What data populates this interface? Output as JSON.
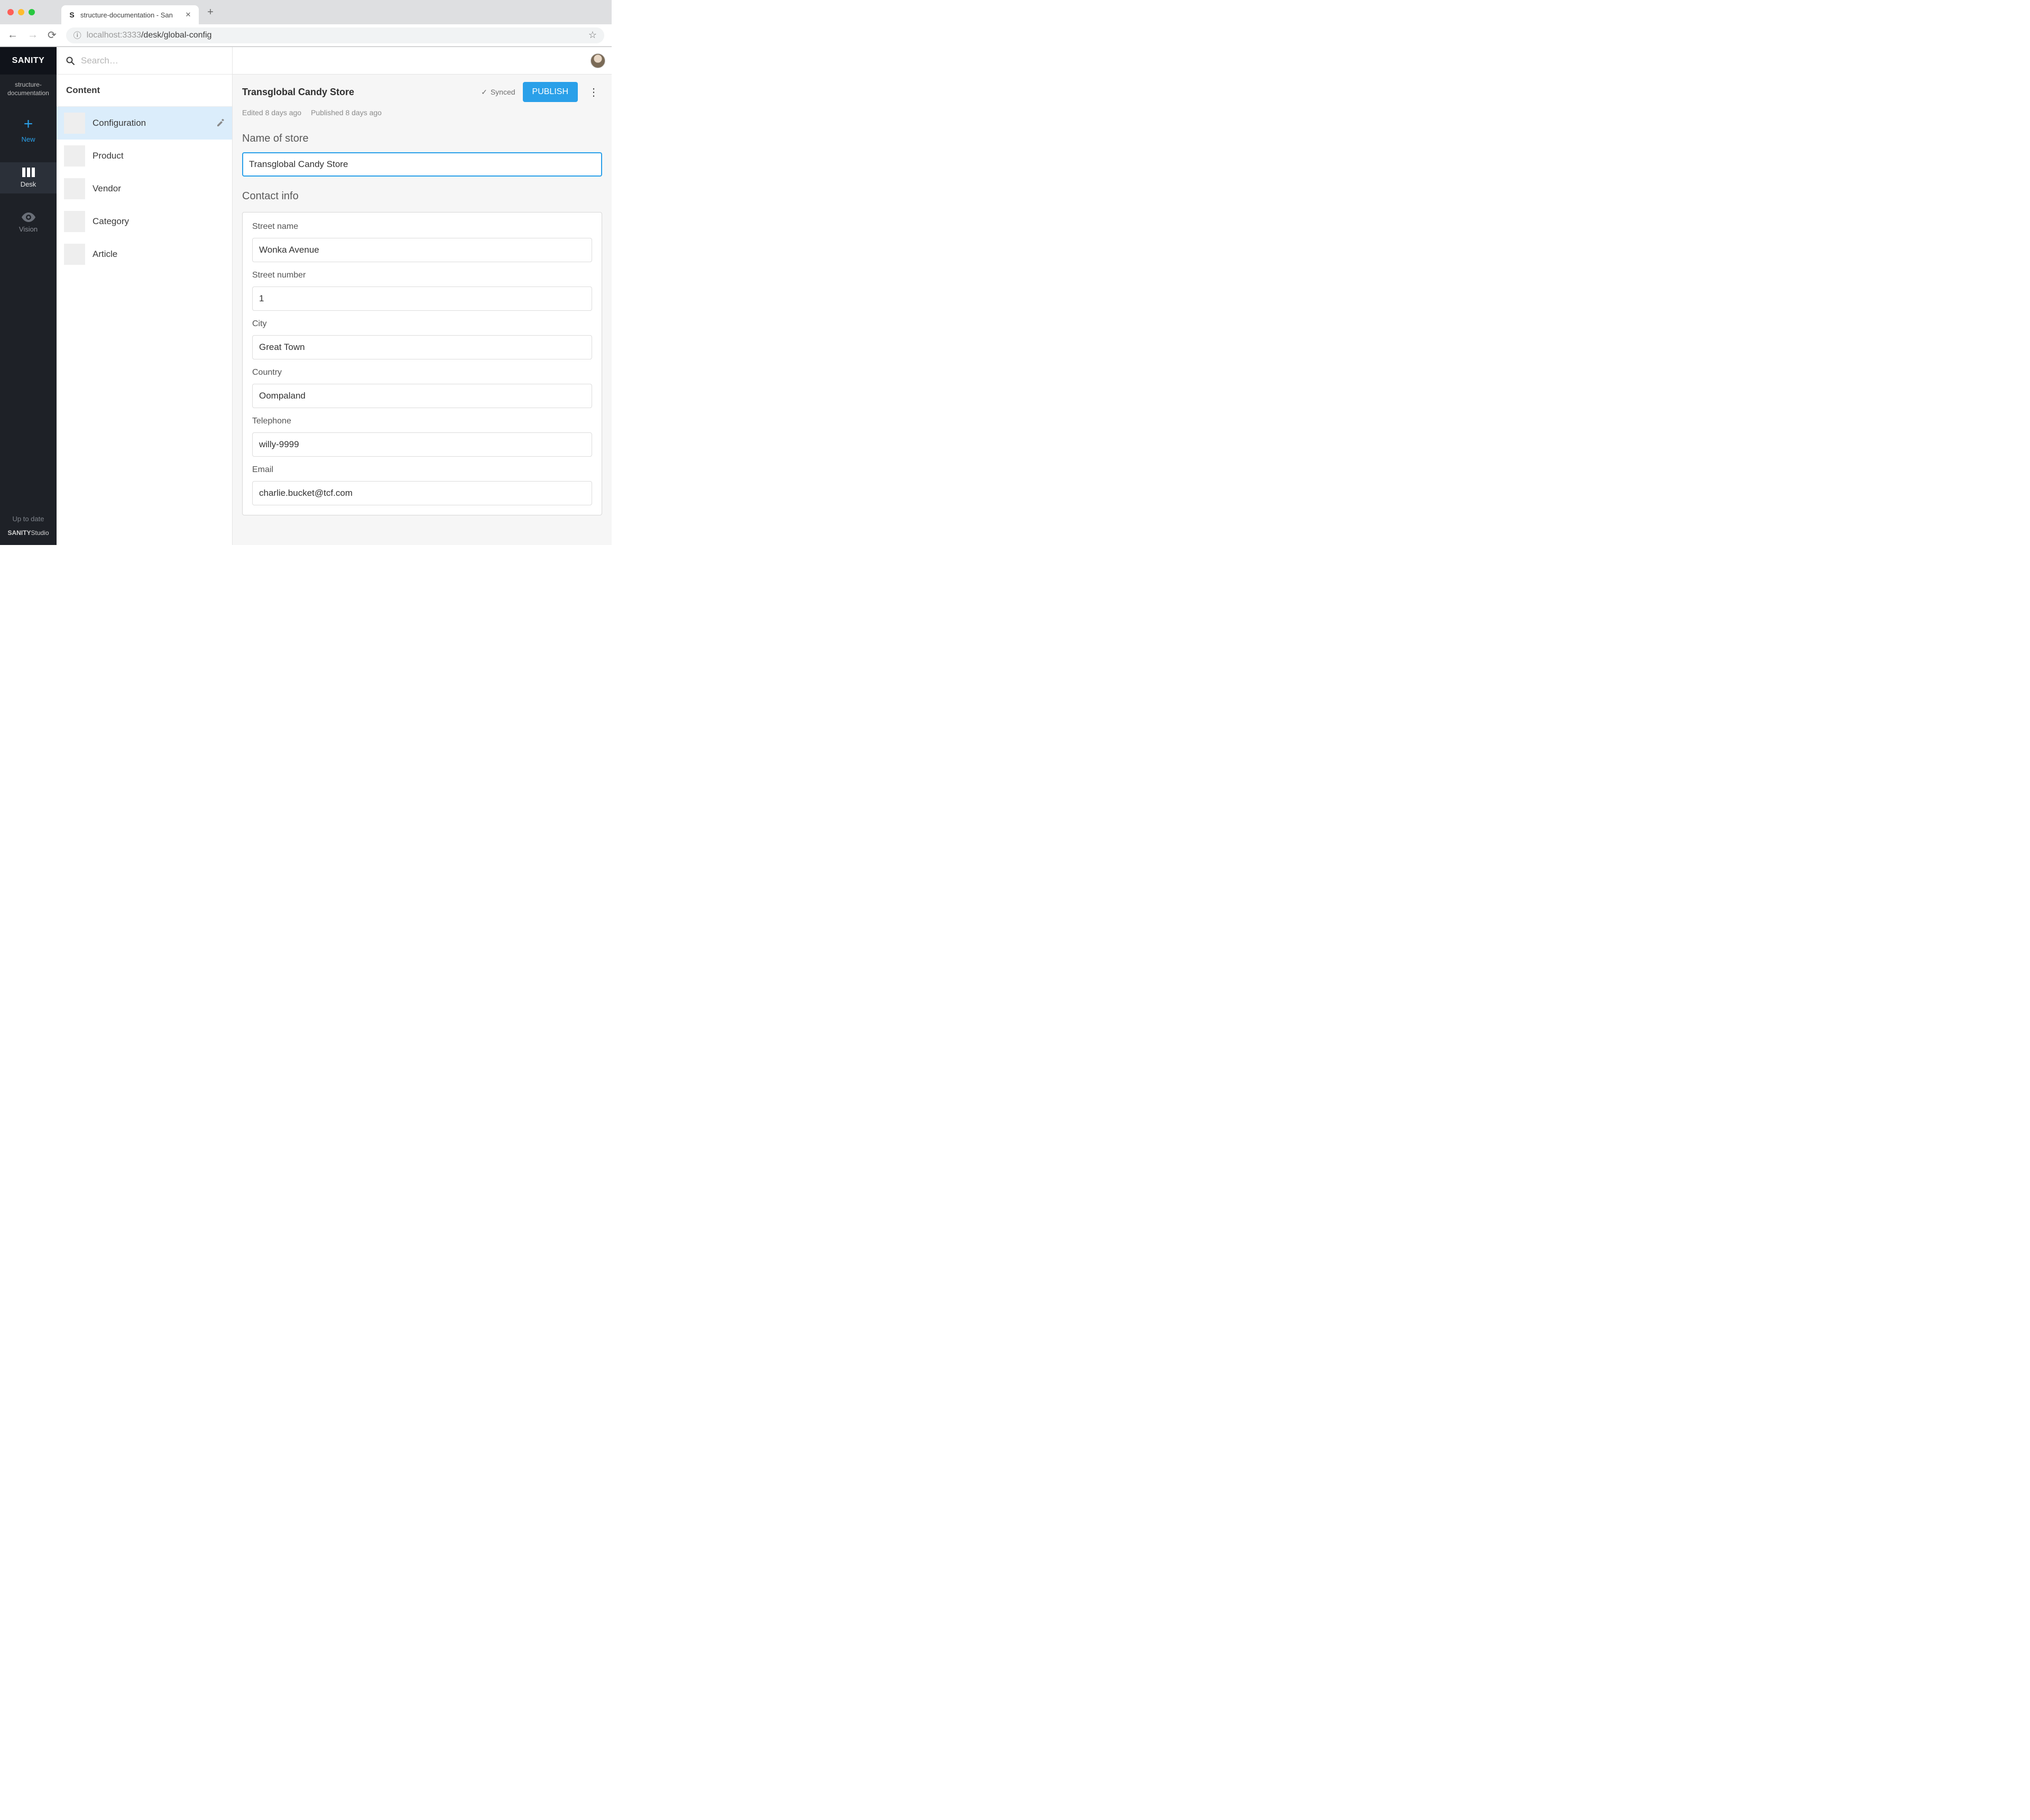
{
  "browser": {
    "tab_title": "structure-documentation - San",
    "url_host": "localhost",
    "url_port": ":3333",
    "url_path": "/desk/global-config"
  },
  "rail": {
    "brand": "SANITY",
    "project_line1": "structure-",
    "project_line2": "documentation",
    "new_label": "New",
    "desk_label": "Desk",
    "vision_label": "Vision",
    "uptodate": "Up to date",
    "studio_bold": "SANITY",
    "studio_light": "Studio"
  },
  "search": {
    "placeholder": "Search…"
  },
  "content": {
    "heading": "Content",
    "items": [
      {
        "label": "Configuration",
        "selected": true,
        "editable": true
      },
      {
        "label": "Product"
      },
      {
        "label": "Vendor"
      },
      {
        "label": "Category"
      },
      {
        "label": "Article"
      }
    ]
  },
  "doc": {
    "title": "Transglobal Candy Store",
    "synced_label": "Synced",
    "publish_label": "PUBLISH",
    "edited": "Edited 8 days ago",
    "published": "Published 8 days ago"
  },
  "form": {
    "name_section": "Name of store",
    "name_value": "Transglobal Candy Store",
    "contact_section": "Contact info",
    "street_name_label": "Street name",
    "street_name_value": "Wonka Avenue",
    "street_number_label": "Street number",
    "street_number_value": "1",
    "city_label": "City",
    "city_value": "Great Town",
    "country_label": "Country",
    "country_value": "Oompaland",
    "telephone_label": "Telephone",
    "telephone_value": "willy-9999",
    "email_label": "Email",
    "email_value": "charlie.bucket@tcf.com"
  }
}
